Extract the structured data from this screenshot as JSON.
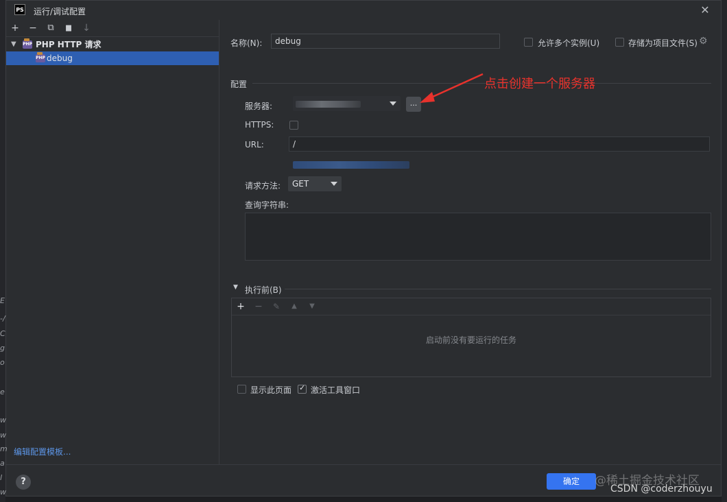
{
  "window": {
    "app_icon": "PS",
    "title": "运行/调试配置",
    "close": "✕"
  },
  "left": {
    "toolbar": [
      {
        "name": "add-icon",
        "glyph": "+"
      },
      {
        "name": "remove-icon",
        "glyph": "−"
      },
      {
        "name": "copy-icon",
        "glyph": "⧉"
      },
      {
        "name": "folder-add-icon",
        "glyph": "▆"
      },
      {
        "name": "sort-icon",
        "glyph": "↓"
      }
    ],
    "tree": {
      "group_label": "PHP HTTP 请求",
      "php_badge": "PHP",
      "items": [
        {
          "label": "debug"
        }
      ]
    },
    "edit_templates_link": "编辑配置模板..."
  },
  "form": {
    "name_label": "名称(N):",
    "name_value": "debug",
    "allow_multiple": "允许多个实例(U)",
    "store_project": "存储为项目文件(S)",
    "config_section": "配置",
    "server_label": "服务器:",
    "server_browse": "...",
    "https_label": "HTTPS:",
    "url_label": "URL:",
    "url_value": "/",
    "method_label": "请求方法:",
    "method_value": "GET",
    "query_label": "查询字符串:",
    "query_value": ""
  },
  "before_launch": {
    "title": "执行前(B)",
    "empty_text": "启动前没有要运行的任务"
  },
  "options": {
    "show_page": "显示此页面",
    "show_page_checked": false,
    "activate_tool": "激活工具窗口",
    "activate_tool_checked": true
  },
  "footer": {
    "help": "?",
    "ok": "确定"
  },
  "annotation": {
    "text": "点击创建一个服务器",
    "color": "#e8322c"
  },
  "watermarks": {
    "juejin": "@稀土掘金技术社区",
    "csdn": "CSDN @coderzhouyu"
  },
  "edge_text": [
    "E",
    "-/",
    "C",
    "g",
    "o",
    "e",
    "w",
    "w",
    "m",
    "a",
    "l",
    "w"
  ],
  "colors": {
    "accent": "#3574f0",
    "selection": "#2e5fb2",
    "background": "#2b2d30",
    "link": "#5c95e6"
  }
}
